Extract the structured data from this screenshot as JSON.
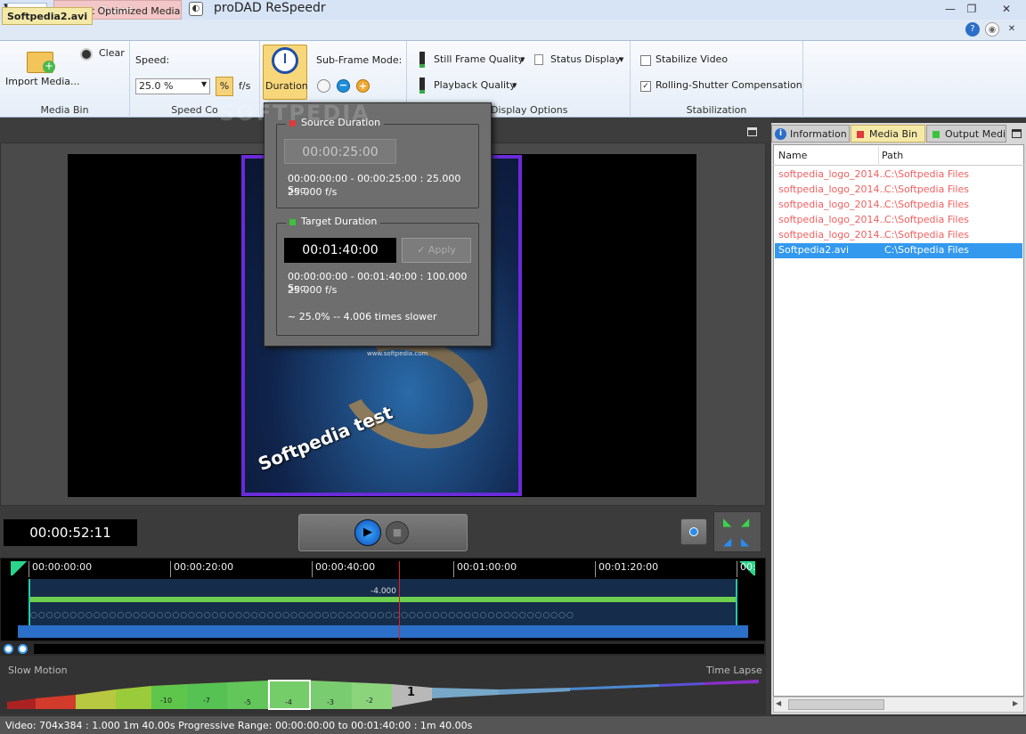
{
  "window": {
    "title": "proDAD ReSpeedr",
    "context_tab": "Export",
    "quick_access": "▼",
    "minimize": "—",
    "restore": "❐",
    "close": "✕"
  },
  "ribbon_tabs": [
    "Start",
    "Export Optimized Media"
  ],
  "help": {
    "help_icon": "?",
    "settings_icon": "◉",
    "close_icon": "✕"
  },
  "media_bin_group": {
    "import_label": "Import Media...",
    "clear_label": "Clear",
    "group_label": "Media Bin"
  },
  "speed_group": {
    "speed_label": "Speed:",
    "speed_value": "25.0 %",
    "percent_label": "%",
    "fps_label": "f/s",
    "group_label": "Speed Co"
  },
  "duration_button": {
    "label": "Duration"
  },
  "subframe": {
    "label": "Sub-Frame Mode:"
  },
  "display_group": {
    "still_frame": "Still Frame Quality",
    "status_display": "Status Display",
    "playback": "Playback Quality",
    "group_label": "Display Options"
  },
  "stabilization_group": {
    "stabilize": "Stabilize Video",
    "stabilize_checked": false,
    "rolling_shutter": "Rolling-Shutter Compensation",
    "rolling_shutter_checked": true,
    "group_label": "Stabilization"
  },
  "document_tab": "Softpedia2.avi",
  "poster": {
    "text": "Softpedia test",
    "url": "www.softpedia.com"
  },
  "watermark": "SOFTPEDIA",
  "popup": {
    "source": {
      "title": "Source Duration",
      "title_color": "#e03a3a",
      "timecode": "00:00:25:00",
      "range": "00:00:00:00 - 00:00:25:00 : 25.000 Sec.",
      "fps": "25.000 f/s"
    },
    "target": {
      "title": "Target Duration",
      "title_color": "#3ac43a",
      "timecode": "00:01:40:00",
      "apply_label": "Apply",
      "range": "00:00:00:00 - 00:01:40:00 : 100.000 Sec.",
      "fps": "25.000 f/s",
      "ratio": "~ 25.0% -- 4.006 times slower"
    }
  },
  "transport": {
    "timecode": "00:00:52:11",
    "play_icon": "▶",
    "stop_icon": "■"
  },
  "timeline": {
    "ticks": [
      "00:00:00:00",
      "00:00:20:00",
      "00:00:40:00",
      "00:01:00:00",
      "00:01:20:00",
      "00:01"
    ],
    "speed_marker": "-4.000",
    "playhead_fraction": 0.52
  },
  "speed_curve": {
    "slow_label": "Slow Motion",
    "fast_label": "Time Lapse",
    "labels": [
      "-10",
      "-7",
      "-5",
      "-4",
      "-3",
      "-2",
      "1"
    ],
    "selected": "-4"
  },
  "status_bar": "Video: 704x384 : 1.000   1m 40.00s   Progressive   Range: 00:00:00:00 to 00:01:40:00 : 1m 40.00s",
  "right_panel": {
    "tabs": [
      "Information",
      "Media Bin",
      "Output Media"
    ],
    "columns": [
      "Name",
      "Path"
    ],
    "rows": [
      {
        "name": "softpedia_logo_2014...",
        "path": "C:\\Softpedia Files"
      },
      {
        "name": "softpedia_logo_2014...",
        "path": "C:\\Softpedia Files"
      },
      {
        "name": "softpedia_logo_2014...",
        "path": "C:\\Softpedia Files"
      },
      {
        "name": "softpedia_logo_2014...",
        "path": "C:\\Softpedia Files"
      },
      {
        "name": "softpedia_logo_2014...",
        "path": "C:\\Softpedia Files"
      },
      {
        "name": "Softpedia2.avi",
        "path": "C:\\Softpedia Files"
      }
    ]
  }
}
